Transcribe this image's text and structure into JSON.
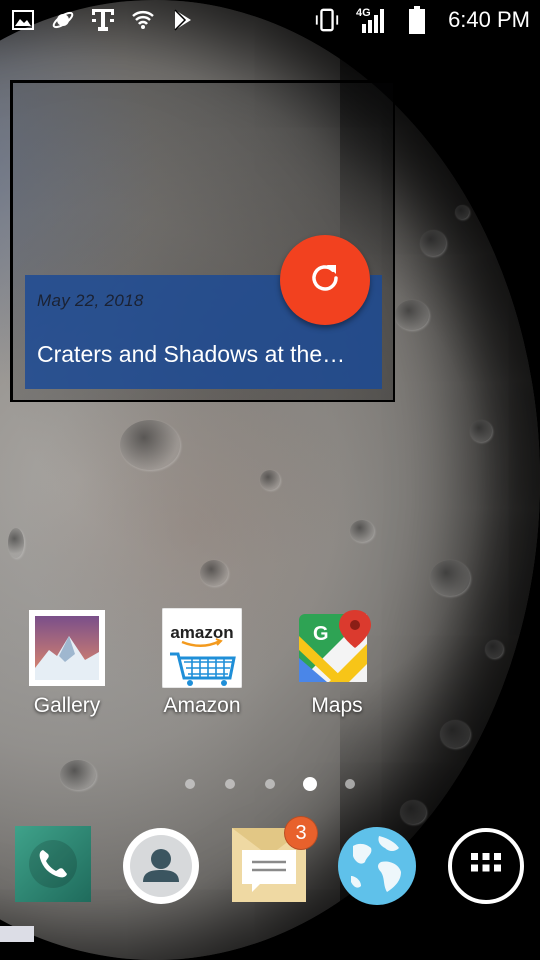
{
  "status_bar": {
    "time": "6:40 PM",
    "network_type": "4G",
    "left_icons": [
      "image-icon",
      "saturn-icon",
      "t-mobile-icon",
      "wifi-icon",
      "play-store-icon"
    ],
    "right_icons": [
      "vibrate-icon",
      "signal-icon",
      "battery-icon"
    ]
  },
  "widget": {
    "date": "May 22, 2018",
    "title": "Craters and Shadows at the…",
    "refresh_icon": "refresh-icon"
  },
  "apps": [
    {
      "label": "Gallery",
      "icon": "gallery-icon"
    },
    {
      "label": "Amazon",
      "icon": "amazon-icon",
      "logo_text": "amazon"
    },
    {
      "label": "Maps",
      "icon": "maps-icon",
      "logo_text": "G"
    }
  ],
  "page_indicator": {
    "count": 5,
    "active": 3
  },
  "dock": {
    "items": [
      {
        "name": "phone",
        "icon": "phone-icon"
      },
      {
        "name": "contacts",
        "icon": "contacts-icon"
      },
      {
        "name": "messages",
        "icon": "messages-icon",
        "badge": "3"
      },
      {
        "name": "browser",
        "icon": "globe-icon"
      },
      {
        "name": "app-drawer",
        "icon": "apps-grid-icon"
      }
    ]
  },
  "colors": {
    "refresh_button": "#f2411f",
    "caption_bg": "#1a4996",
    "badge": "#e8612c"
  }
}
